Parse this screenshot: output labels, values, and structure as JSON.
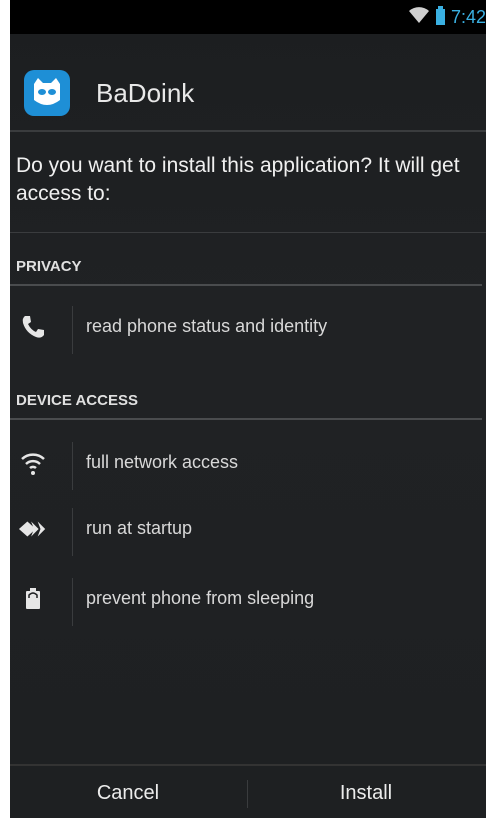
{
  "status_bar": {
    "time": "7:42",
    "wifi_icon": "wifi-icon",
    "battery_icon": "battery-icon"
  },
  "app": {
    "title": "BaDoink",
    "icon": "app-icon",
    "accent": "#1e8fd6"
  },
  "prompt": {
    "question": "Do you want to install this application? It will get access to:"
  },
  "sections": [
    {
      "header": "PRIVACY",
      "items": [
        {
          "icon": "phone-icon",
          "label": "read phone status and identity"
        }
      ]
    },
    {
      "header": "DEVICE ACCESS",
      "items": [
        {
          "icon": "wifi-icon",
          "label": "full network access"
        },
        {
          "icon": "startup-arrows-icon",
          "label": "run at startup"
        },
        {
          "icon": "battery-lock-icon",
          "label": "prevent phone from sleeping"
        }
      ]
    }
  ],
  "buttons": {
    "cancel": "Cancel",
    "install": "Install"
  },
  "colors": {
    "status_accent": "#3ab0e2",
    "background": "#1e2022"
  }
}
